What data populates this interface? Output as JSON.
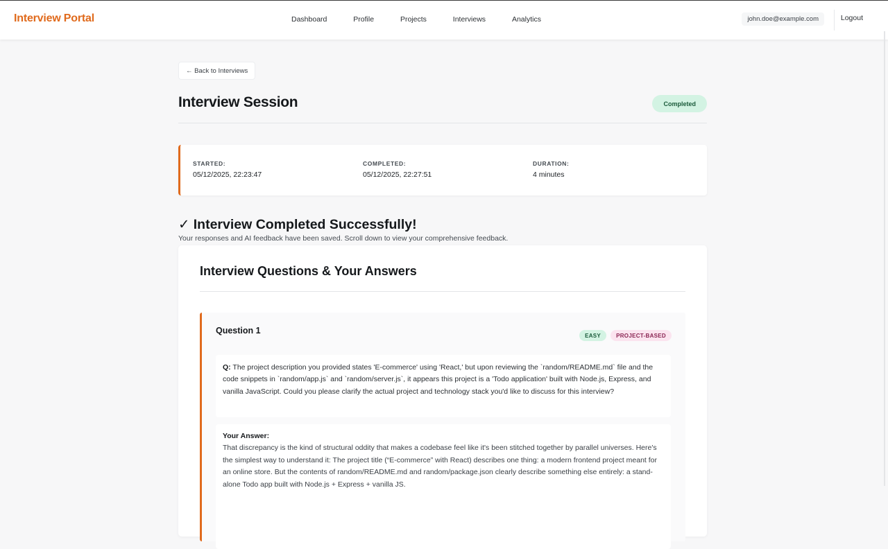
{
  "nav": {
    "brand": "Interview Portal",
    "links": [
      "Dashboard",
      "Profile",
      "Projects",
      "Interviews",
      "Analytics"
    ],
    "user_email": "john.doe@example.com",
    "logout": "Logout"
  },
  "page": {
    "back_label": "← Back to Interviews",
    "title": "Interview Session",
    "status": "Completed"
  },
  "meta": {
    "started_label": "STARTED:",
    "started_value": "05/12/2025, 22:23:47",
    "completed_label": "COMPLETED:",
    "completed_value": "05/12/2025, 22:27:51",
    "duration_label": "DURATION:",
    "duration_value": "4 minutes"
  },
  "success": {
    "title": "✓ Interview Completed Successfully!",
    "subtitle": "Your responses and AI feedback have been saved. Scroll down to view your comprehensive feedback."
  },
  "qa": {
    "heading": "Interview Questions & Your Answers",
    "questions": [
      {
        "title": "Question 1",
        "tags": [
          "EASY",
          "PROJECT-BASED"
        ],
        "q_prefix": "Q:",
        "question": "The project description you provided states 'E-commerce' using 'React,' but upon reviewing the `random/README.md` file and the code snippets in `random/app.js` and `random/server.js`, it appears this project is a 'Todo application' built with Node.js, Express, and vanilla JavaScript. Could you please clarify the actual project and technology stack you'd like to discuss for this interview?",
        "answer_label": "Your Answer:",
        "answer": "That discrepancy is the kind of structural oddity that makes a codebase feel like it's been stitched together by parallel universes. Here's the simplest way to understand it: The project title (“E-commerce” with React) describes one thing: a modern frontend project meant for an online store. But the contents of random/README.md and random/package.json clearly describe something else entirely: a stand-alone Todo app built with Node.js + Express + vanilla JS."
      }
    ]
  },
  "colors": {
    "accent": "#e06a1c",
    "status_bg": "#d3f3e3",
    "tag_project_bg": "#fbe4ef"
  }
}
